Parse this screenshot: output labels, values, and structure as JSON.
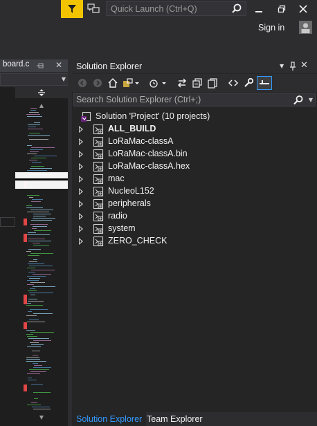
{
  "titlebar": {
    "quick_launch_placeholder": "Quick Launch (Ctrl+Q)",
    "sign_in": "Sign in",
    "accent": "#f2c400"
  },
  "editor": {
    "tab_label": "board.c"
  },
  "solution_explorer": {
    "title": "Solution Explorer",
    "search_placeholder": "Search Solution Explorer (Ctrl+;)",
    "solution_label": "Solution 'Project' (10 projects)",
    "projects": [
      {
        "label": "ALL_BUILD",
        "bold": true
      },
      {
        "label": "LoRaMac-classA",
        "bold": false
      },
      {
        "label": "LoRaMac-classA.bin",
        "bold": false
      },
      {
        "label": "LoRaMac-classA.hex",
        "bold": false
      },
      {
        "label": "mac",
        "bold": false
      },
      {
        "label": "NucleoL152",
        "bold": false
      },
      {
        "label": "peripherals",
        "bold": false
      },
      {
        "label": "radio",
        "bold": false
      },
      {
        "label": "system",
        "bold": false
      },
      {
        "label": "ZERO_CHECK",
        "bold": false
      }
    ]
  },
  "bottom_tabs": {
    "solution_explorer": "Solution Explorer",
    "team_explorer": "Team Explorer"
  }
}
